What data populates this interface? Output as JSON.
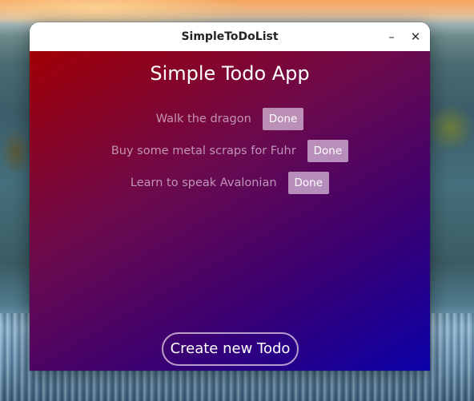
{
  "window": {
    "title": "SimpleToDoList",
    "minimize_icon": "minimize-icon",
    "minimize_glyph": "–",
    "close_icon": "close-icon",
    "close_glyph": "✕"
  },
  "app": {
    "heading": "Simple Todo App",
    "todos": [
      {
        "text": "Walk the dragon",
        "done_label": "Done"
      },
      {
        "text": "Buy some metal scraps for Fuhr",
        "done_label": "Done"
      },
      {
        "text": "Learn to speak Avalonian",
        "done_label": "Done"
      }
    ],
    "create_label": "Create new Todo"
  },
  "colors": {
    "gradient_start": "#a10005",
    "gradient_end": "#0a00a8",
    "titlebar": "#ffffff"
  }
}
